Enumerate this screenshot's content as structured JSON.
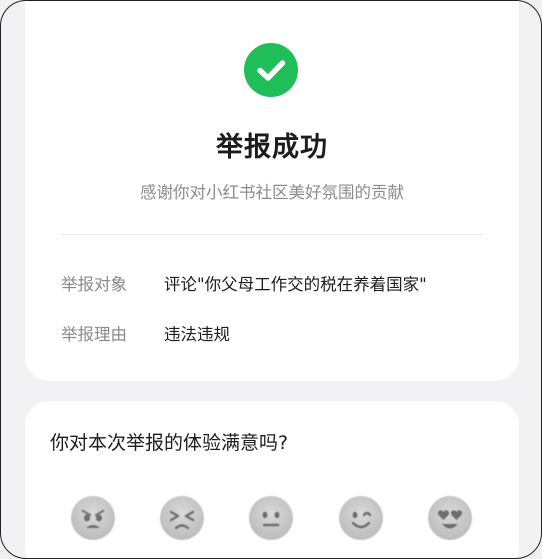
{
  "success": {
    "title": "举报成功",
    "subtitle": "感谢你对小红书社区美好氛围的贡献",
    "check_color": "#1fbe59",
    "rows": [
      {
        "label": "举报对象",
        "value": "评论\"你父母工作交的税在养着国家\""
      },
      {
        "label": "举报理由",
        "value": "违法违规"
      }
    ]
  },
  "survey": {
    "question": "你对本次举报的体验满意吗?",
    "ratings": [
      {
        "icon": "very-dissatisfied-face-icon"
      },
      {
        "icon": "dissatisfied-face-icon"
      },
      {
        "icon": "neutral-face-icon"
      },
      {
        "icon": "satisfied-face-icon"
      },
      {
        "icon": "very-satisfied-face-icon"
      }
    ]
  }
}
